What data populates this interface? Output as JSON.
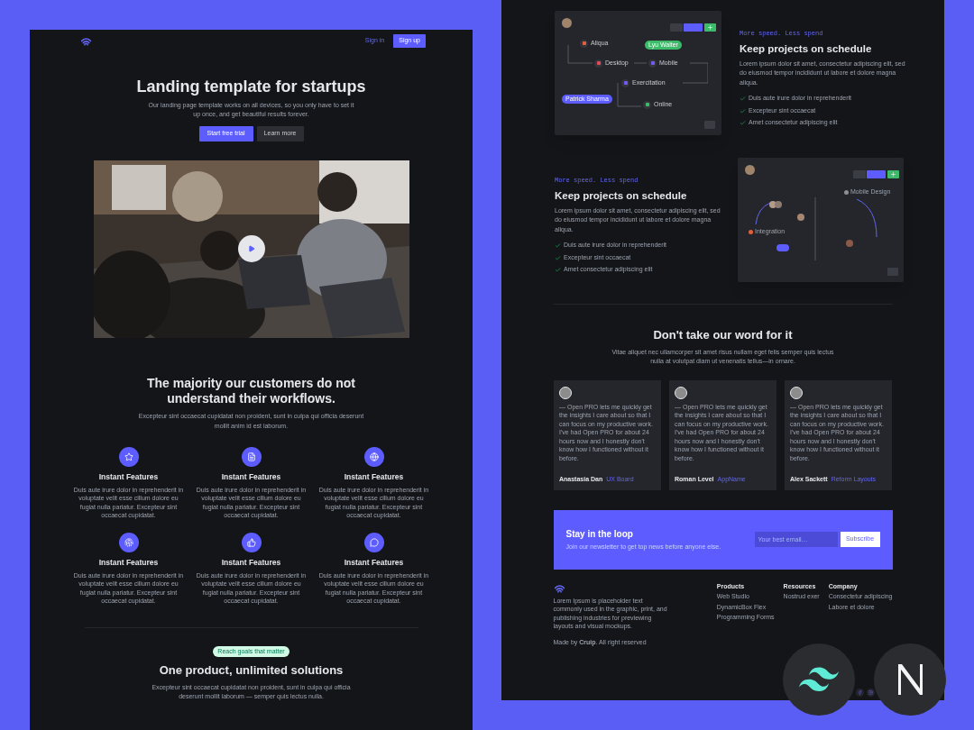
{
  "left_page": {
    "nav": {
      "links": [
        {
          "label": "Sign in",
          "kind": "link"
        },
        {
          "label": "Sign up",
          "kind": "button"
        }
      ]
    },
    "hero": {
      "title": "Landing template for startups",
      "subtitle": "Our landing page template works on all devices, so you only have to set it up once, and get beautiful results forever.",
      "buttons": [
        {
          "label": "Start free trial",
          "kind": "primary"
        },
        {
          "label": "Learn more",
          "kind": "secondary"
        }
      ]
    },
    "workflows": {
      "title": "The majority our customers do not understand their workflows.",
      "subtitle": "Excepteur sint occaecat cupidatat non proident, sunt in culpa qui officia deserunt mollit anim id est laborum.",
      "features": [
        {
          "title": "Instant Features",
          "text": "Duis aute irure dolor in reprehenderit in voluptate velit esse cillum dolore eu fugiat nulla pariatur. Excepteur sint occaecat cupidatat."
        },
        {
          "title": "Instant Features",
          "text": "Duis aute irure dolor in reprehenderit in voluptate velit esse cillum dolore eu fugiat nulla pariatur. Excepteur sint occaecat cupidatat."
        },
        {
          "title": "Instant Features",
          "text": "Duis aute irure dolor in reprehenderit in voluptate velit esse cillum dolore eu fugiat nulla pariatur. Excepteur sint occaecat cupidatat."
        },
        {
          "title": "Instant Features",
          "text": "Duis aute irure dolor in reprehenderit in voluptate velit esse cillum dolore eu fugiat nulla pariatur. Excepteur sint occaecat cupidatat."
        },
        {
          "title": "Instant Features",
          "text": "Duis aute irure dolor in reprehenderit in voluptate velit esse cillum dolore eu fugiat nulla pariatur. Excepteur sint occaecat cupidatat."
        },
        {
          "title": "Instant Features",
          "text": "Duis aute irure dolor in reprehenderit in voluptate velit esse cillum dolore eu fugiat nulla pariatur. Excepteur sint occaecat cupidatat."
        }
      ]
    },
    "solutions": {
      "badge": "Reach goals that matter",
      "title": "One product, unlimited solutions",
      "subtitle": "Excepteur sint occaecat cupidatat non proident, sunt in culpa qui officia deserunt mollit laborum — semper quis lectus nulla."
    }
  },
  "right_page": {
    "features": [
      {
        "tag": "More speed. Less spend",
        "title": "Keep projects on schedule",
        "text": "Lorem ipsum dolor sit amet, consectetur adipiscing elit, sed do eiusmod tempor incididunt ut labore et dolore magna aliqua.",
        "checklist": [
          "Duis aute irure dolor in reprehenderit",
          "Excepteur sint occaecat",
          "Amet consectetur adipiscing elit"
        ],
        "diagram": {
          "labels": [
            {
              "kind": "node",
              "text": "Aliqua",
              "color": "#e0603a"
            },
            {
              "kind": "pill",
              "text": "Lyu Walter",
              "color": "#3dbb6a"
            },
            {
              "kind": "node",
              "text": "Desktop",
              "color": "#e04a5a"
            },
            {
              "kind": "node",
              "text": "Mobile",
              "color": "#6d5df5"
            },
            {
              "kind": "node",
              "text": "Exercitation",
              "color": "#6d5df5"
            },
            {
              "kind": "pill",
              "text": "Patrick Sharma",
              "color": "#5d5dff"
            },
            {
              "kind": "node",
              "text": "Online",
              "color": "#3dbb6a"
            }
          ]
        }
      },
      {
        "tag": "More speed. Less spend",
        "title": "Keep projects on schedule",
        "text": "Lorem ipsum dolor sit amet, consectetur adipiscing elit, sed do eiusmod tempor incididunt ut labore et dolore magna aliqua.",
        "checklist": [
          "Duis aute irure dolor in reprehenderit",
          "Excepteur sint occaecat",
          "Amet consectetur adipiscing elit"
        ],
        "diagram": {
          "labels": [
            {
              "kind": "tag",
              "text": "Mobile Design",
              "color": "#8a8f98"
            },
            {
              "kind": "tag",
              "text": "Integration",
              "color": "#e0603a"
            }
          ]
        }
      }
    ],
    "testimonials": {
      "title": "Don't take our word for it",
      "subtitle": "Vitae aliquet nec ullamcorper sit amet risus nullam eget felis semper quis lectus nulla at volutpat diam ut venenatis tellus—in ornare.",
      "items": [
        {
          "quote": "— Open PRO lets me quickly get the insights I care about so that I can focus on my productive work. I've had Open PRO for about 24 hours now and I honestly don't know how I functioned without it before.",
          "name": "Anastasia Dan",
          "company": "UX Board"
        },
        {
          "quote": "— Open PRO lets me quickly get the insights I care about so that I can focus on my productive work. I've had Open PRO for about 24 hours now and I honestly don't know how I functioned without it before.",
          "name": "Roman Level",
          "company": "AppName"
        },
        {
          "quote": "— Open PRO lets me quickly get the insights I care about so that I can focus on my productive work. I've had Open PRO for about 24 hours now and I honestly don't know how I functioned without it before.",
          "name": "Alex Sackett",
          "company": "Reform Layouts"
        }
      ]
    },
    "newsletter": {
      "title": "Stay in the loop",
      "text": "Join our newsletter to get top news before anyone else.",
      "placeholder": "Your best email…",
      "button": "Subscribe"
    },
    "footer": {
      "text": "Lorem Ipsum is placeholder text commonly used in the graphic, print, and publishing industries for previewing layouts and visual mockups.",
      "copyright": "Made by **Cruip**. All right reserved",
      "columns": [
        {
          "title": "Products",
          "links": [
            "Web Studio",
            "DynamicBox Flex",
            "Programming Forms"
          ]
        },
        {
          "title": "Resources",
          "links": [
            "Nostrud exer"
          ]
        },
        {
          "title": "Company",
          "links": [
            "Consectetur adipiscing",
            "Labore et dolore"
          ]
        }
      ]
    }
  }
}
